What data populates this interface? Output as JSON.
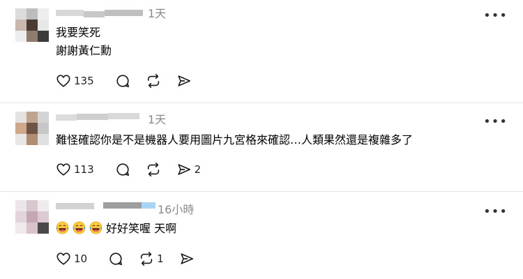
{
  "posts": [
    {
      "time": "1天",
      "lines": [
        "我要笑死",
        "謝謝黃仁勳"
      ],
      "likes": "135",
      "reposts": "",
      "shares": ""
    },
    {
      "time": "1天",
      "lines": [
        "難怪確認你是不是機器人要用圖片九宮格來確認…人類果然還是複雜多了"
      ],
      "likes": "113",
      "reposts": "",
      "shares": "2"
    },
    {
      "time": "16小時",
      "emojis": [
        "laughing-face",
        "laughing-face",
        "laughing-face"
      ],
      "text": "好好笑喔 天啊",
      "likes": "10",
      "reposts": "1",
      "shares": ""
    }
  ],
  "colors": {
    "text": "#000000",
    "muted": "#8a8a8a",
    "divider": "#e5e5e5",
    "verified_blur": "#a9d4f3"
  },
  "icons": [
    "heart-icon",
    "comment-icon",
    "repost-icon",
    "share-icon",
    "more-icon"
  ]
}
